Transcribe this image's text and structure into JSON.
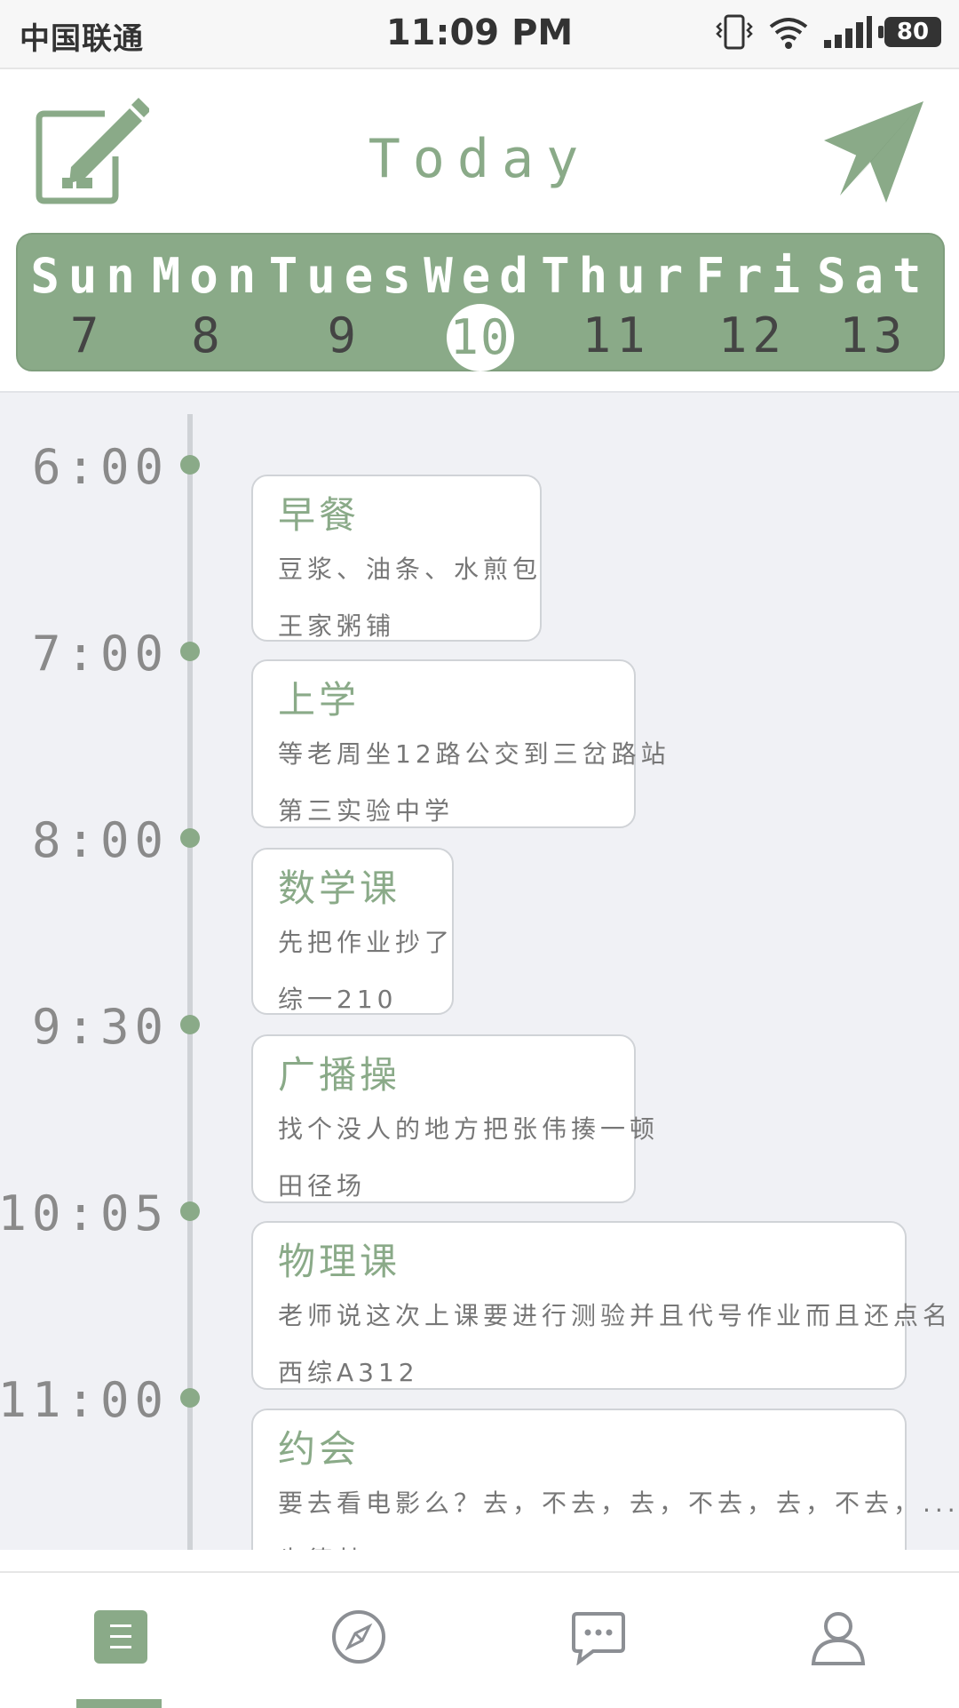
{
  "status_bar": {
    "carrier": "中国联通",
    "time": "11:09 PM",
    "battery": "80"
  },
  "header": {
    "title": "Today",
    "left_icon": "edit-icon",
    "right_icon": "send-icon"
  },
  "week": {
    "days": [
      {
        "name": "Sun",
        "num": "7"
      },
      {
        "name": "Mon",
        "num": "8"
      },
      {
        "name": "Tues",
        "num": "9"
      },
      {
        "name": "Wed",
        "num": "10"
      },
      {
        "name": "Thur",
        "num": "11"
      },
      {
        "name": "Fri",
        "num": "12"
      },
      {
        "name": "Sat",
        "num": "13"
      }
    ],
    "selected_day": "10"
  },
  "timeline": {
    "times": [
      "6:00",
      "7:00",
      "8:00",
      "9:30",
      "10:05",
      "11:00"
    ],
    "events": [
      {
        "title": "早餐",
        "desc": "豆浆、油条、水煎包",
        "location": "王家粥铺"
      },
      {
        "title": "上学",
        "desc": "等老周坐12路公交到三岔路站",
        "location": "第三实验中学"
      },
      {
        "title": "数学课",
        "desc": "先把作业抄了",
        "location": "综一210"
      },
      {
        "title": "广播操",
        "desc": "找个没人的地方把张伟揍一顿",
        "location": "田径场"
      },
      {
        "title": "物理课",
        "desc": "老师说这次上课要进行测验并且代号作业而且还点名",
        "location": "西综A312"
      },
      {
        "title": "约会",
        "desc": "要去看电影么？去，不去，去，不去，去，不去，...",
        "location": "肯德基"
      }
    ]
  },
  "bottom_nav": {
    "items": [
      "list-icon",
      "compass-icon",
      "chat-icon",
      "user-icon"
    ],
    "active": "list-icon"
  },
  "colors": {
    "accent": "#8aaa88",
    "background": "#f0f1f5",
    "text_muted": "#777777"
  }
}
